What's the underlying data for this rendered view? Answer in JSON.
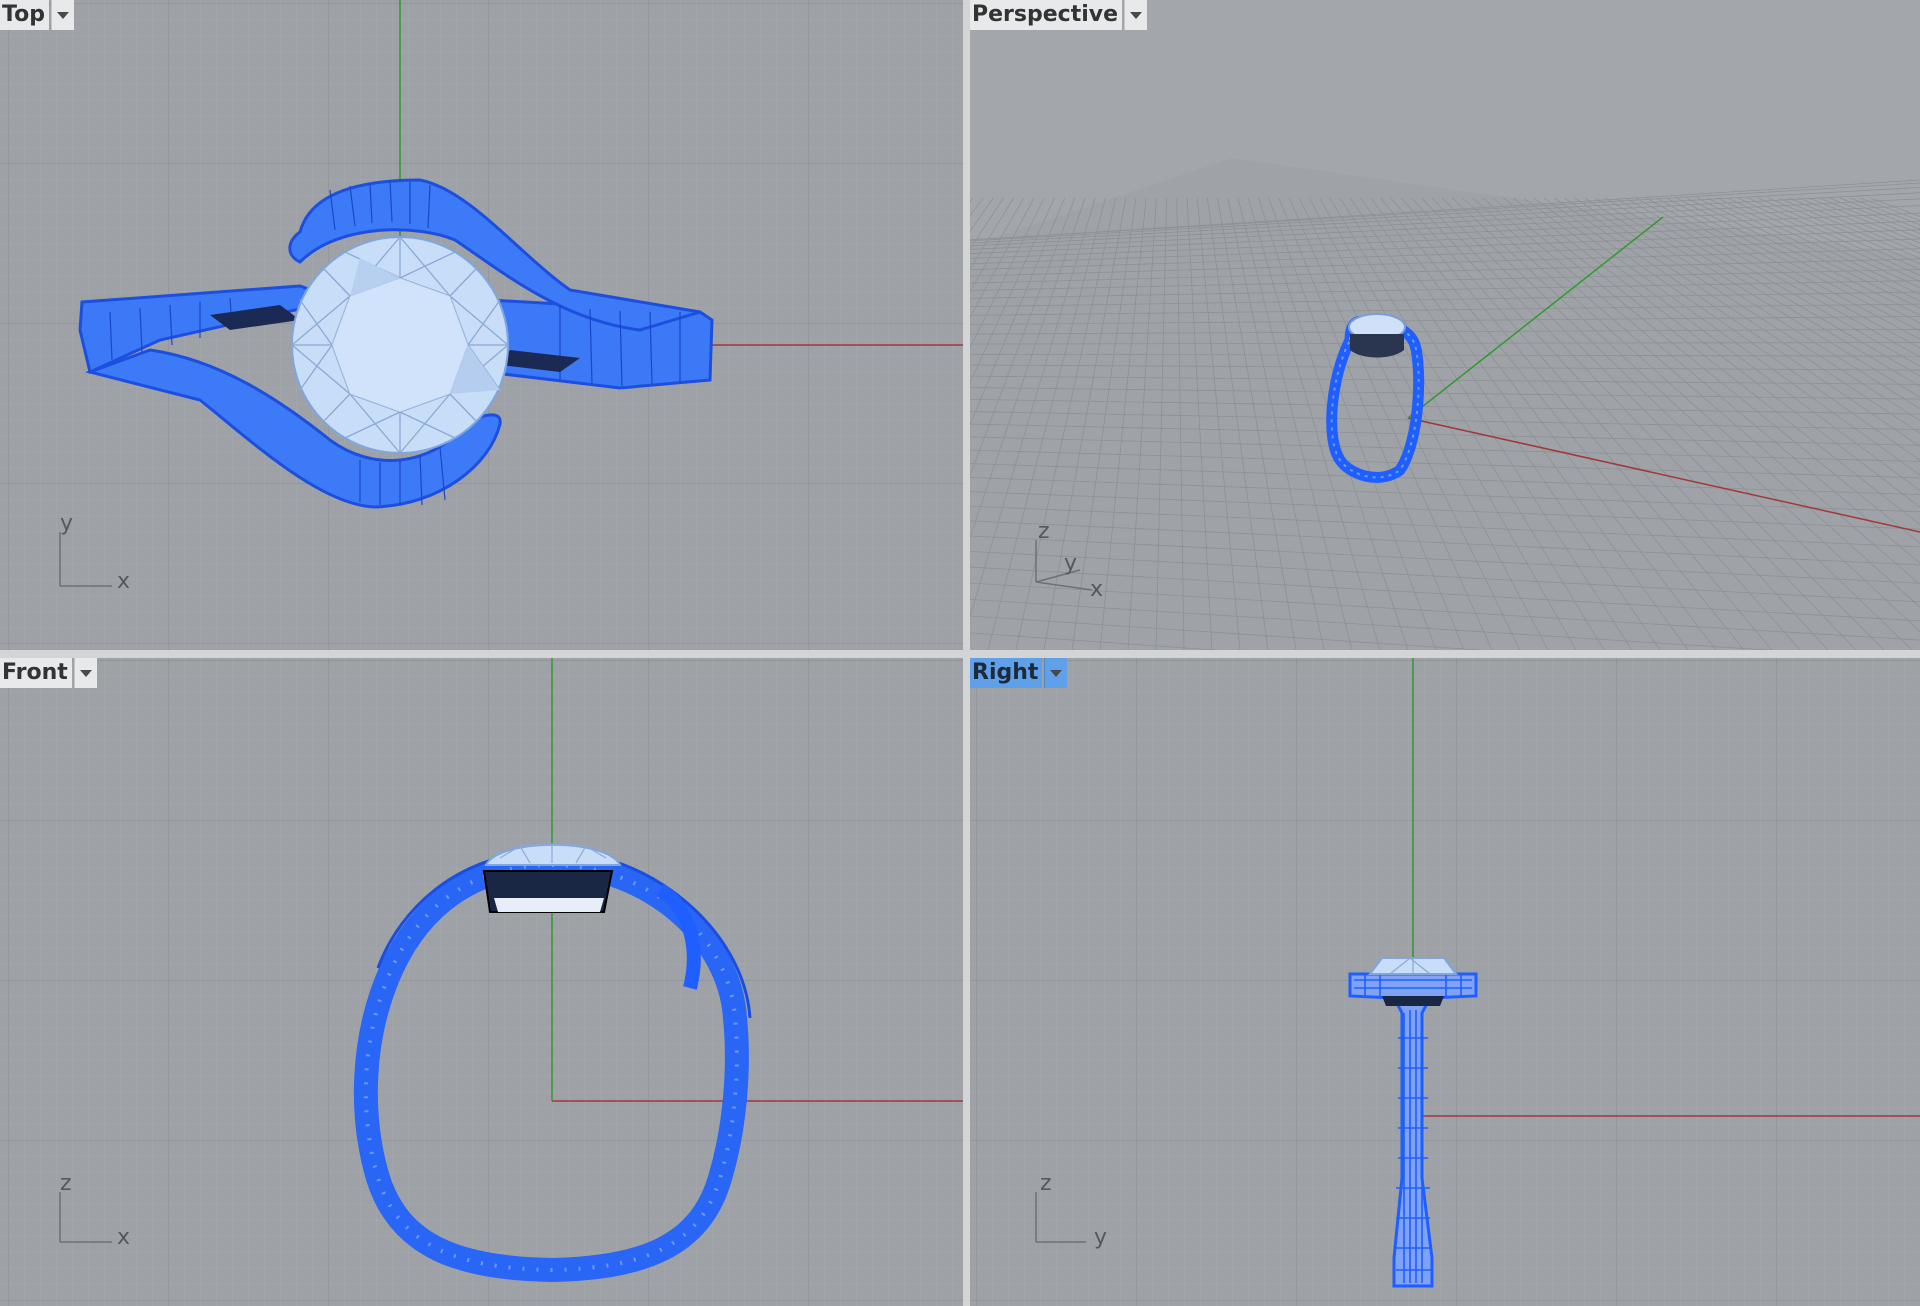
{
  "viewports": {
    "top": {
      "label": "Top",
      "axes": {
        "vertical": "y",
        "horizontal": "x"
      }
    },
    "perspective": {
      "label": "Perspective",
      "axes": {
        "z": "z",
        "y": "y",
        "x": "x"
      }
    },
    "front": {
      "label": "Front",
      "axes": {
        "vertical": "z",
        "horizontal": "x"
      }
    },
    "right": {
      "label": "Right",
      "axes": {
        "vertical": "z",
        "horizontal": "y"
      }
    }
  },
  "active_viewport": "Right",
  "colors": {
    "viewport_bg": "#9ca0a5",
    "grid_minor": "#a9adb1",
    "grid_major": "#8b8f93",
    "x_axis": "#a03838",
    "y_axis": "#2f9a2f",
    "selection_blue": "#1f5fff",
    "gem": "#c6dcf7",
    "active_tab": "#5fa0e8"
  },
  "icons": {
    "viewport_menu": "chevron-down-icon"
  }
}
